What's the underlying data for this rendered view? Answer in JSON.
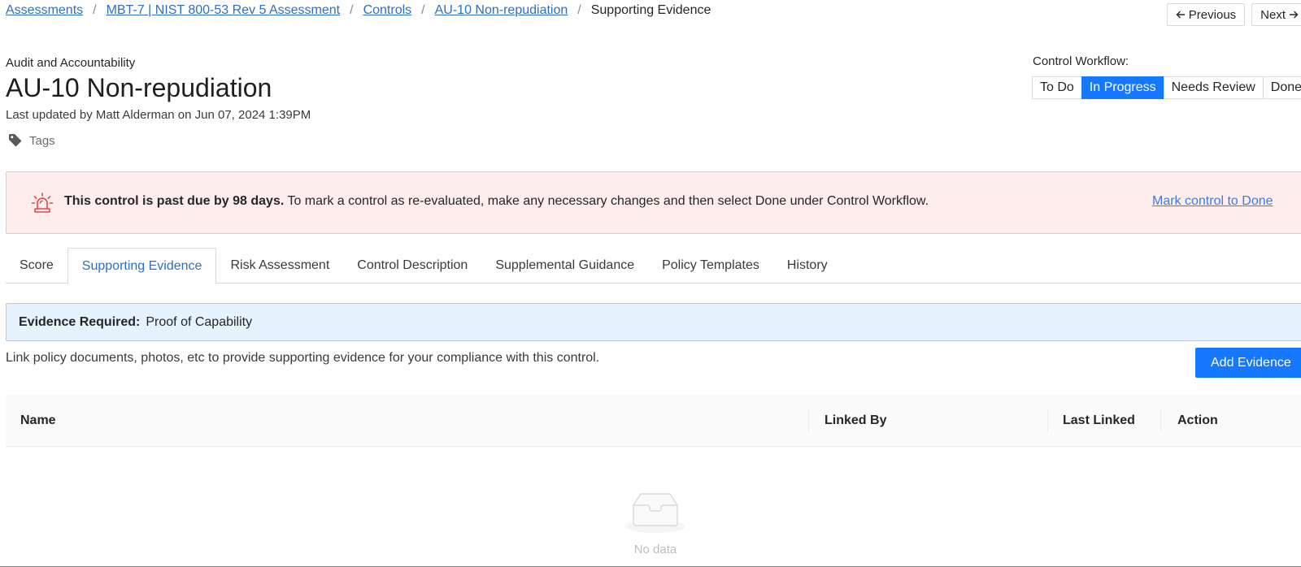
{
  "breadcrumb": {
    "items": [
      "Assessments",
      "MBT-7 | NIST 800-53 Rev 5 Assessment",
      "Controls",
      "AU-10 Non-repudiation"
    ],
    "current": "Supporting Evidence",
    "separator": "/"
  },
  "pager": {
    "previous": "Previous",
    "next": "Next"
  },
  "header": {
    "family": "Audit and Accountability",
    "title": "AU-10 Non-repudiation",
    "updated": "Last updated by Matt Alderman on Jun 07, 2024 1:39PM",
    "tags_label": "Tags"
  },
  "workflow": {
    "label": "Control Workflow:",
    "options": [
      "To Do",
      "In Progress",
      "Needs Review",
      "Done"
    ],
    "selected": "In Progress"
  },
  "alert": {
    "bold": "This control is past due by 98 days.",
    "text": "To mark a control as re-evaluated, make any necessary changes and then select Done under Control Workflow.",
    "link": "Mark control to Done",
    "icon": "alarm-siren-icon"
  },
  "tabs": [
    "Score",
    "Supporting Evidence",
    "Risk Assessment",
    "Control Description",
    "Supplemental Guidance",
    "Policy Templates",
    "History"
  ],
  "active_tab": "Supporting Evidence",
  "evidence": {
    "label": "Evidence Required:",
    "value": "Proof of Capability",
    "description": "Link policy documents, photos, etc to provide supporting evidence for your compliance with this control.",
    "add_button": "Add Evidence"
  },
  "table": {
    "columns": [
      "Name",
      "Linked By",
      "Last Linked",
      "Action"
    ],
    "empty_text": "No data",
    "empty_icon": "empty-inbox-icon"
  },
  "colors": {
    "primary": "#1677ff",
    "link": "#2f6fc0",
    "alert_bg": "#fdeeed",
    "alert_icon": "#e5484d",
    "info_bg": "#e6f2fd"
  }
}
